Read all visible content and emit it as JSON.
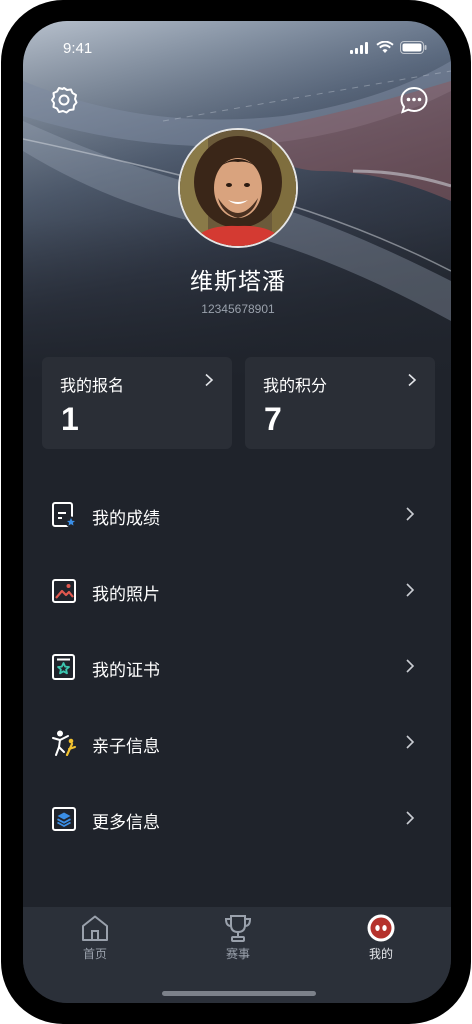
{
  "status_bar": {
    "time": "9:41"
  },
  "profile": {
    "name": "维斯塔潘",
    "id": "12345678901"
  },
  "cards": [
    {
      "label": "我的报名",
      "value": "1"
    },
    {
      "label": "我的积分",
      "value": "7"
    }
  ],
  "menu": [
    {
      "label": "我的成绩",
      "icon": "score-document-icon"
    },
    {
      "label": "我的照片",
      "icon": "photo-icon"
    },
    {
      "label": "我的证书",
      "icon": "certificate-icon"
    },
    {
      "label": "亲子信息",
      "icon": "parent-child-icon"
    },
    {
      "label": "更多信息",
      "icon": "layers-icon"
    }
  ],
  "tabs": [
    {
      "label": "首页",
      "icon": "home-icon"
    },
    {
      "label": "赛事",
      "icon": "trophy-icon"
    },
    {
      "label": "我的",
      "icon": "mine-icon",
      "active": true
    }
  ],
  "colors": {
    "background": "#1f232b",
    "card": "#2a2e36",
    "tabbar": "#2b3039",
    "accent_teal": "#3cc6b0",
    "accent_blue": "#3a8ee6",
    "accent_red": "#e0584f",
    "accent_yellow": "#f2c230"
  }
}
